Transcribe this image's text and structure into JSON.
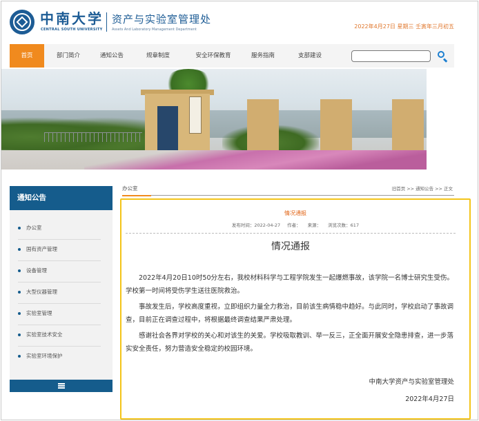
{
  "header": {
    "logo_cn": "中南大学",
    "logo_en": "CENTRAL SOUTH UNIVERSITY",
    "dept_cn": "资产与实验室管理处",
    "dept_en": "Assets And Laboratory Management Department",
    "date_line": "2022年4月27日  星期三  壬寅年三月初五"
  },
  "nav": {
    "items": [
      "首页",
      "部门简介",
      "通知公告",
      "规章制度",
      "安全环保教育",
      "服务指南",
      "支部建设"
    ],
    "active_index": 0,
    "search_placeholder": "",
    "search_icon": "search-icon"
  },
  "sidebar": {
    "title": "通知公告",
    "items": [
      "办公室",
      "国有资产管理",
      "设备管理",
      "大型仪器管理",
      "实验室管理",
      "实验室技术安全",
      "实验室环境保护"
    ],
    "menu_icon": "menu-icon"
  },
  "breadcrumb": {
    "tab": "办公室",
    "path": [
      "旧首页",
      ">>",
      "通知公告",
      ">>",
      "正文"
    ]
  },
  "article": {
    "label": "情况通报",
    "meta": {
      "date": "发布时间：2022-04-27",
      "author": "作者：",
      "source": "来源：",
      "views": "浏览次数：617"
    },
    "title": "情况通报",
    "paragraphs": [
      "2022年4月20日10时50分左右，我校材料科学与工程学院发生一起爆燃事故，该学院一名博士研究生受伤。学校第一时间将受伤学生送往医院救治。",
      "事故发生后，学校高度重视，立即组织力量全力救治，目前该生病情稳中趋好。与此同时，学校启动了事故调查，目前正在调查过程中，将根据最终调查结果严肃处理。",
      "感谢社会各界对学校的关心和对该生的关爱。学校吸取教训、举一反三，正全面开展安全隐患排查，进一步落实安全责任，努力营造安全稳定的校园环境。"
    ],
    "signature": "中南大学资产与实验室管理处",
    "date": "2022年4月27日"
  },
  "colors": {
    "brand_blue": "#1d5c95",
    "sidebar_blue": "#155c8c",
    "nav_active": "#f08a1e",
    "highlight_border": "#f3c418",
    "date_orange": "#e0772c"
  }
}
